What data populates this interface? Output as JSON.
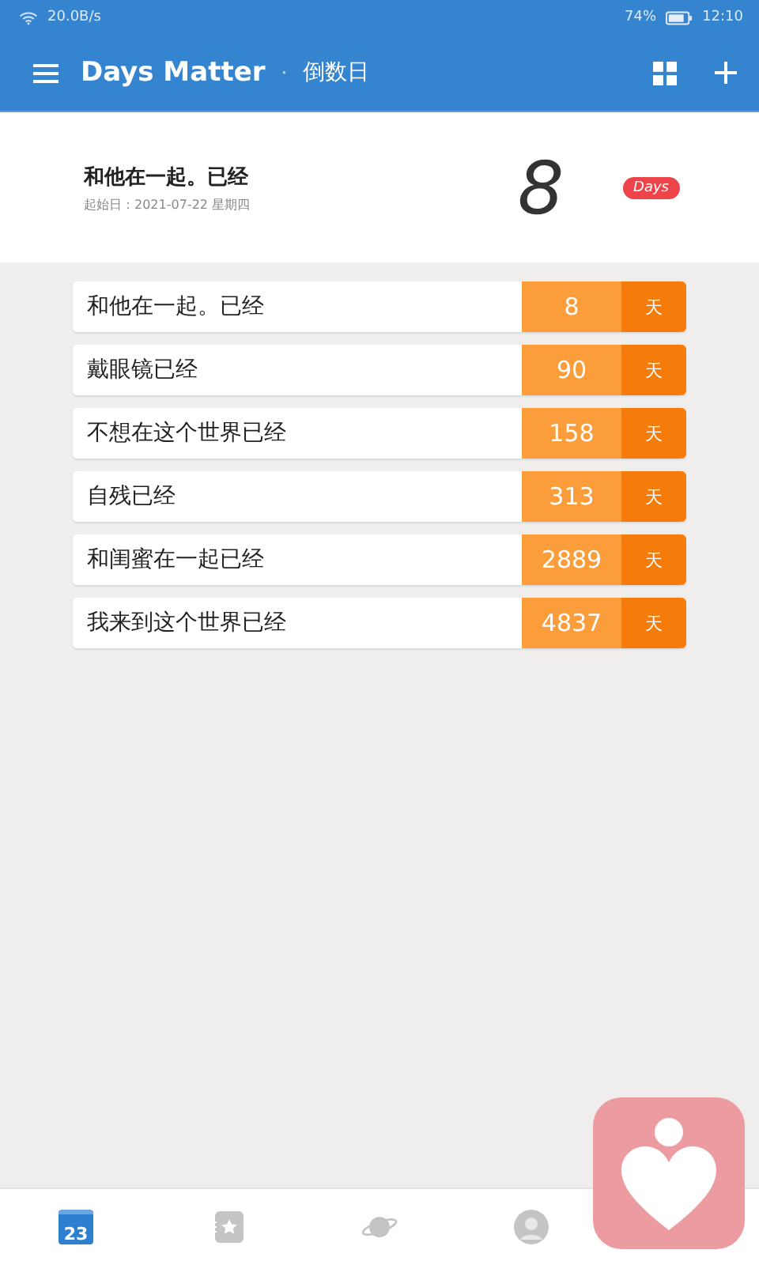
{
  "status_bar": {
    "speed": "20.0B/s",
    "battery": "74%",
    "time": "12:10"
  },
  "app_bar": {
    "title": "Days Matter",
    "separator": "·",
    "subtitle": "倒数日"
  },
  "highlight": {
    "title": "和他在一起。已经",
    "start_date": "起始日：2021-07-22 星期四",
    "count": "8",
    "badge": "Days"
  },
  "events": [
    {
      "name": "和他在一起。已经",
      "count": "8",
      "unit": "天"
    },
    {
      "name": "戴眼镜已经",
      "count": "90",
      "unit": "天"
    },
    {
      "name": "不想在这个世界已经",
      "count": "158",
      "unit": "天"
    },
    {
      "name": "自残已经",
      "count": "313",
      "unit": "天"
    },
    {
      "name": "和闺蜜在一起已经",
      "count": "2889",
      "unit": "天"
    },
    {
      "name": "我来到这个世界已经",
      "count": "4837",
      "unit": "天"
    }
  ],
  "bottom_nav": [
    {
      "kind": "calendar",
      "label": "23",
      "selected": true
    },
    {
      "kind": "favorites",
      "selected": false
    },
    {
      "kind": "planet",
      "selected": false
    },
    {
      "kind": "profile",
      "selected": false
    }
  ]
}
